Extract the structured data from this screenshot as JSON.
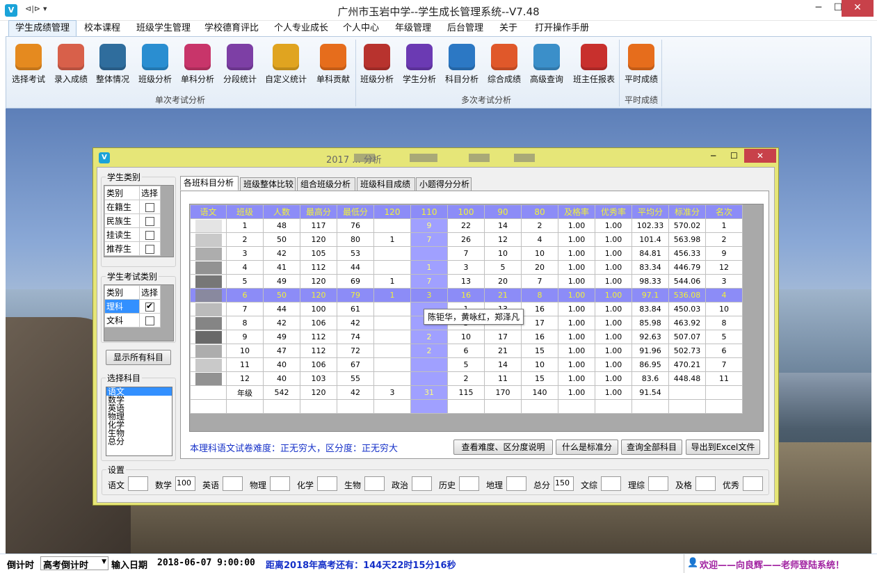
{
  "app": {
    "title": "广州市玉岩中学--学生成长管理系统--V7.48",
    "icon": "V",
    "quick_access": [
      "⊲|⊳",
      "▾"
    ],
    "window_controls": [
      "minimize-icon",
      "maximize-icon",
      "close-icon"
    ]
  },
  "menu": {
    "items": [
      "学生成绩管理",
      "校本课程",
      "班级学生管理",
      "学校德育评比",
      "个人专业成长",
      "个人中心",
      "年级管理",
      "后台管理",
      "关于",
      "打开操作手册"
    ]
  },
  "ribbon": {
    "buttons": [
      {
        "label": "选择考试",
        "color": "#e58a1f",
        "icon": "download-icon"
      },
      {
        "label": "录入成绩",
        "color": "#d8604a",
        "icon": "notepad-pencil-icon"
      },
      {
        "label": "整体情况",
        "color": "#2f6d9d",
        "icon": "layers-icon"
      },
      {
        "label": "班级分析",
        "color": "#2a8ed1",
        "icon": "line-chart-icon"
      },
      {
        "label": "单科分析",
        "color": "#c8356a",
        "icon": "bookmark-icon"
      },
      {
        "label": "分段统计",
        "color": "#7d3fa5",
        "icon": "palette-icon"
      },
      {
        "label": "自定义统计",
        "color": "#e0a420",
        "icon": "shield-icon"
      },
      {
        "label": "单科贡献",
        "color": "#e66d1c",
        "icon": "compass-icon"
      },
      {
        "label": "班级分析",
        "color": "#b8332e",
        "icon": "book-icon"
      },
      {
        "label": "学生分析",
        "color": "#6b3ab3",
        "icon": "bar-chart-icon"
      },
      {
        "label": "科目分析",
        "color": "#2c78c4",
        "icon": "document-list-icon"
      },
      {
        "label": "综合成绩",
        "color": "#e0582a",
        "icon": "clipboard-icon"
      },
      {
        "label": "高级查询",
        "color": "#3b8fc9",
        "icon": "card-icon"
      },
      {
        "label": "班主任报表",
        "color": "#c8302d",
        "icon": "briefcase-icon"
      },
      {
        "label": "平时成绩",
        "color": "#e66d1c",
        "icon": "report-icon"
      }
    ],
    "groups": [
      "单次考试分析",
      "多次考试分析",
      "平时成绩"
    ]
  },
  "dialog": {
    "title_visible": "2017 ... 分析",
    "student_type": {
      "legend": "学生类别",
      "headers": [
        "类别",
        "选择"
      ],
      "rows": [
        {
          "name": "在籍生",
          "checked": false
        },
        {
          "name": "民族生",
          "checked": false
        },
        {
          "name": "挂读生",
          "checked": false
        },
        {
          "name": "推荐生",
          "checked": false
        }
      ]
    },
    "exam_type": {
      "legend": "学生考试类别",
      "headers": [
        "类别",
        "选择"
      ],
      "rows": [
        {
          "name": "理科",
          "checked": true
        },
        {
          "name": "文科",
          "checked": false
        }
      ]
    },
    "show_all_button": "显示所有科目",
    "subject_select": {
      "legend": "选择科目",
      "items": [
        "语文",
        "数学",
        "英语",
        "物理",
        "化学",
        "生物",
        "总分"
      ],
      "selected": "语文"
    },
    "tabs": [
      "各班科目分析",
      "班级整体比较",
      "组合班级分析",
      "班级科目成绩",
      "小题得分分析"
    ],
    "grid": {
      "headers": [
        "语文",
        "班级",
        "人数",
        "最高分",
        "最低分",
        "120",
        "110",
        "100",
        "90",
        "80",
        "及格率",
        "优秀率",
        "平均分",
        "标准分",
        "名次"
      ],
      "rows": [
        [
          "1",
          "48",
          "117",
          "76",
          "",
          "9",
          "22",
          "14",
          "2",
          "1.00",
          "1.00",
          "102.33",
          "570.02",
          "1"
        ],
        [
          "2",
          "50",
          "120",
          "80",
          "1",
          "7",
          "26",
          "12",
          "4",
          "1.00",
          "1.00",
          "101.4",
          "563.98",
          "2"
        ],
        [
          "3",
          "42",
          "105",
          "53",
          "",
          "",
          "7",
          "10",
          "10",
          "1.00",
          "1.00",
          "84.81",
          "456.33",
          "9"
        ],
        [
          "4",
          "41",
          "112",
          "44",
          "",
          "1",
          "3",
          "5",
          "20",
          "1.00",
          "1.00",
          "83.34",
          "446.79",
          "12"
        ],
        [
          "5",
          "49",
          "120",
          "69",
          "1",
          "7",
          "13",
          "20",
          "7",
          "1.00",
          "1.00",
          "98.33",
          "544.06",
          "3"
        ],
        [
          "6",
          "50",
          "120",
          "79",
          "1",
          "3",
          "16",
          "21",
          "8",
          "1.00",
          "1.00",
          "97.1",
          "536.08",
          "4"
        ],
        [
          "7",
          "44",
          "100",
          "61",
          "",
          "",
          "1",
          "13",
          "16",
          "1.00",
          "1.00",
          "83.84",
          "450.03",
          "10"
        ],
        [
          "8",
          "42",
          "106",
          "42",
          "",
          "",
          "3",
          "",
          "17",
          "1.00",
          "1.00",
          "85.98",
          "463.92",
          "8"
        ],
        [
          "9",
          "49",
          "112",
          "74",
          "",
          "2",
          "10",
          "17",
          "16",
          "1.00",
          "1.00",
          "92.63",
          "507.07",
          "5"
        ],
        [
          "10",
          "47",
          "112",
          "72",
          "",
          "2",
          "6",
          "21",
          "15",
          "1.00",
          "1.00",
          "91.96",
          "502.73",
          "6"
        ],
        [
          "11",
          "40",
          "106",
          "67",
          "",
          "",
          "5",
          "14",
          "10",
          "1.00",
          "1.00",
          "86.95",
          "470.21",
          "7"
        ],
        [
          "12",
          "40",
          "103",
          "55",
          "",
          "",
          "2",
          "11",
          "15",
          "1.00",
          "1.00",
          "83.6",
          "448.48",
          "11"
        ],
        [
          "年级",
          "542",
          "120",
          "42",
          "3",
          "31",
          "115",
          "170",
          "140",
          "1.00",
          "1.00",
          "91.54",
          "",
          ""
        ],
        [
          "",
          "",
          "",
          "",
          "",
          "",
          "",
          "",
          "",
          "",
          "",
          "",
          "",
          ""
        ]
      ],
      "highlighted_row": 5
    },
    "tooltip": "陈钜华，黄咏红，郑泽凡",
    "note": "本理科语文试卷难度：正无穷大，区分度：正无穷大",
    "buttons": [
      "查看难度、区分度说明",
      "什么是标准分",
      "查询全部科目",
      "导出到Excel文件"
    ],
    "settings": {
      "legend": "设置",
      "fields": [
        {
          "label": "语文",
          "value": ""
        },
        {
          "label": "数学",
          "value": "100"
        },
        {
          "label": "英语",
          "value": ""
        },
        {
          "label": "物理",
          "value": ""
        },
        {
          "label": "化学",
          "value": ""
        },
        {
          "label": "生物",
          "value": ""
        },
        {
          "label": "政治",
          "value": ""
        },
        {
          "label": "历史",
          "value": ""
        },
        {
          "label": "地理",
          "value": ""
        },
        {
          "label": "总分",
          "value": "150"
        },
        {
          "label": "文综",
          "value": ""
        },
        {
          "label": "理综",
          "value": ""
        },
        {
          "label": "及格",
          "value": ""
        },
        {
          "label": "优秀",
          "value": ""
        }
      ]
    }
  },
  "status": {
    "countdown_label": "倒计时",
    "countdown_select": "高考倒计时",
    "date_label": "输入日期",
    "date_value": "2018-06-07  9:00:00",
    "remaining": "距离2018年高考还有：144天22时15分16秒",
    "welcome": "欢迎——向良辉——老师登陆系统！"
  }
}
